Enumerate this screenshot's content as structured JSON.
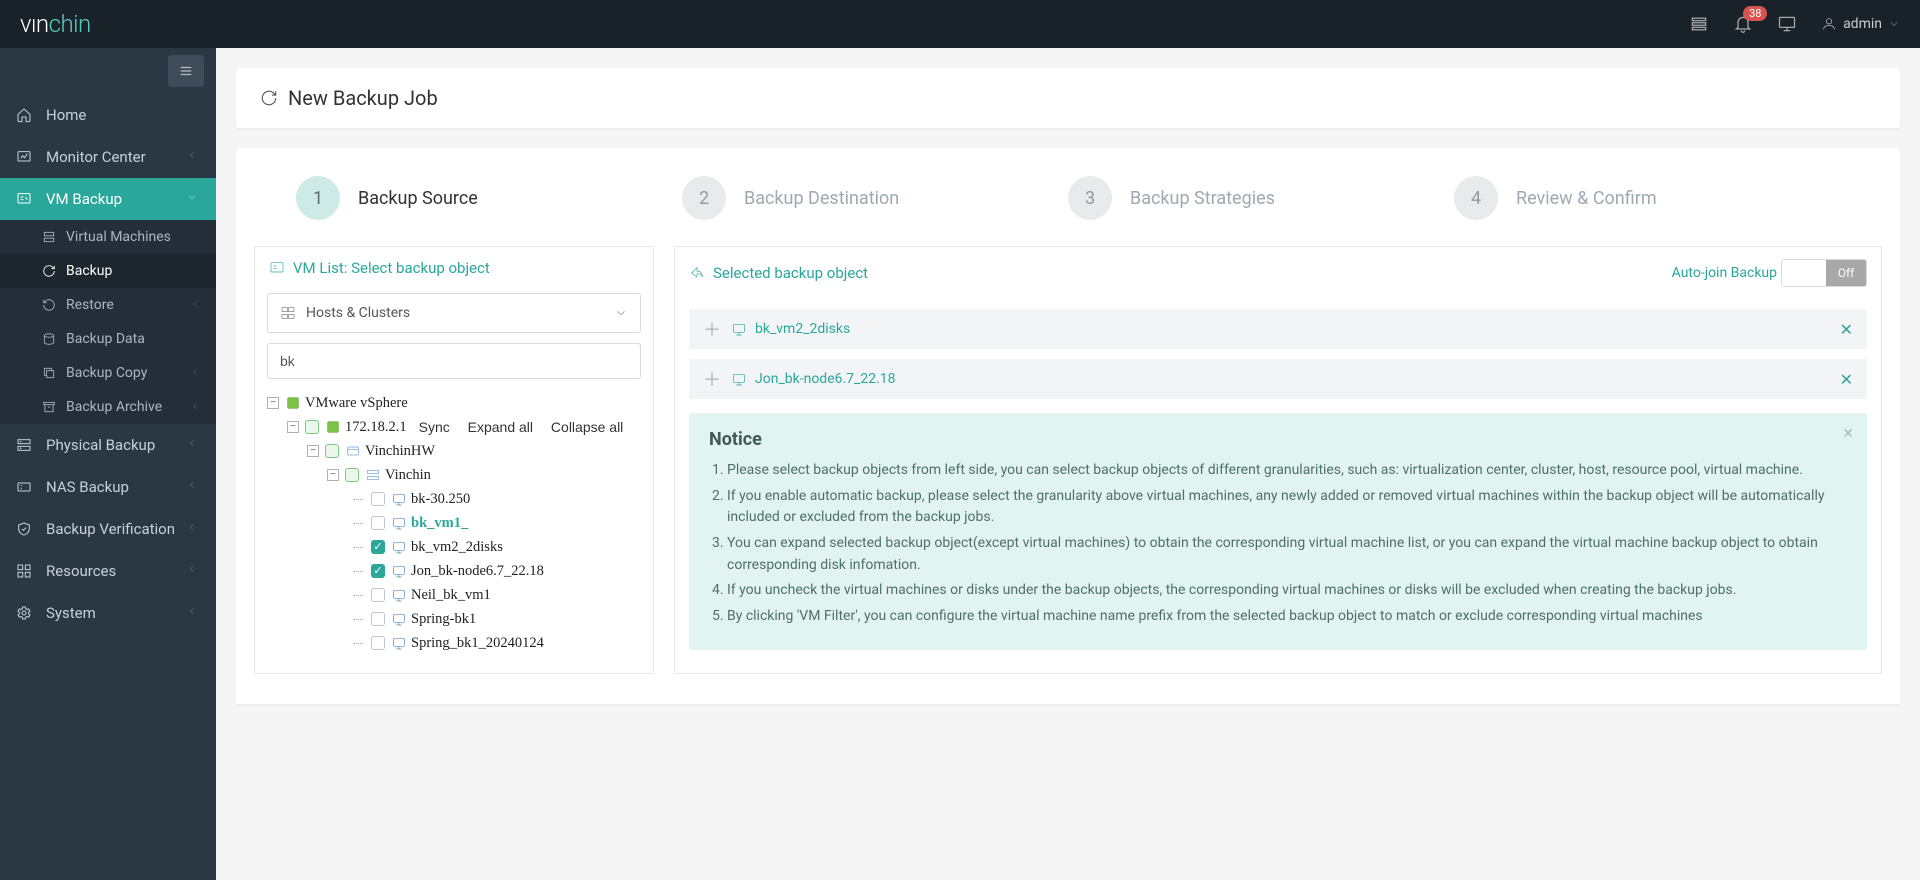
{
  "brand": {
    "part1": "vın",
    "part2": "chin"
  },
  "topbar": {
    "badge": "38",
    "user": "admin"
  },
  "sidebar": {
    "home": "Home",
    "monitor": "Monitor Center",
    "vmBackup": "VM Backup",
    "vmSub": {
      "vms": "Virtual Machines",
      "backup": "Backup",
      "restore": "Restore",
      "backupData": "Backup Data",
      "backupCopy": "Backup Copy",
      "backupArchive": "Backup Archive"
    },
    "physical": "Physical Backup",
    "nas": "NAS Backup",
    "verification": "Backup Verification",
    "resources": "Resources",
    "system": "System"
  },
  "page": {
    "title": "New Backup Job"
  },
  "steps": {
    "s1n": "1",
    "s1l": "Backup Source",
    "s2n": "2",
    "s2l": "Backup Destination",
    "s3n": "3",
    "s3l": "Backup Strategies",
    "s4n": "4",
    "s4l": "Review & Confirm"
  },
  "leftPanel": {
    "title": "VM List: Select backup object",
    "hostsLabel": "Hosts & Clusters",
    "searchValue": "bk",
    "treeLinks": {
      "sync": "Sync",
      "expand": "Expand all",
      "collapse": "Collapse all"
    },
    "tree": {
      "root": "VMware vSphere",
      "host": "172.18.2.1",
      "dc": "VinchinHW",
      "cluster": "Vinchin",
      "vms": {
        "v0": "bk-30.250",
        "v1": "bk_vm1_",
        "v2": "bk_vm2_2disks",
        "v3": "Jon_bk-node6.7_22.18",
        "v4": "Neil_bk_vm1",
        "v5": "Spring-bk1",
        "v6": "Spring_bk1_20240124"
      }
    }
  },
  "rightPanel": {
    "title": "Selected backup object",
    "autojoin": "Auto-join Backup",
    "toggleOff": "Off",
    "selected": {
      "i0": "bk_vm2_2disks",
      "i1": "Jon_bk-node6.7_22.18"
    },
    "noticeTitle": "Notice",
    "notice": {
      "n1": "Please select backup objects from left side, you can select backup objects of different granularities, such as: virtualization center, cluster, host, resource pool, virtual machine.",
      "n2": "If you enable automatic backup, please select the granularity above virtual machines, any newly added or removed virtual machines within the backup object will be automatically included or excluded from the backup jobs.",
      "n3": "You can expand selected backup object(except virtual machines) to obtain the corresponding virtual machine list, or you can expand the virtual machine backup object to obtain corresponding disk infomation.",
      "n4": "If you uncheck the virtual machines or disks under the backup objects, the corresponding virtual machines or disks will be excluded when creating the backup jobs.",
      "n5": "By clicking 'VM Filter', you can configure the virtual machine name prefix from the selected backup object to match or exclude corresponding virtual machines"
    }
  }
}
